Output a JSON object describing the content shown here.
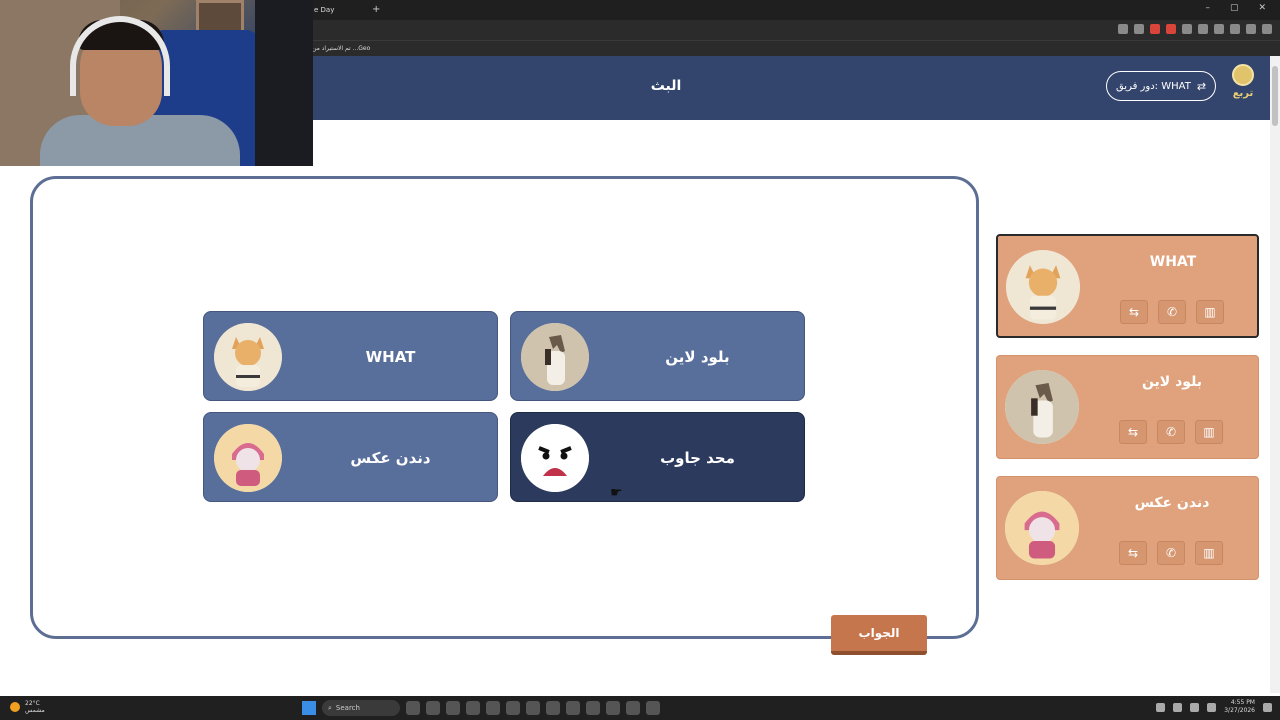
{
  "browser": {
    "tab_label": "e Day",
    "new_tab": "+",
    "bookmark_label": "تم الاستيراد من ...Geo",
    "window_controls": [
      "–",
      "▢",
      "✕"
    ]
  },
  "header": {
    "title": "البث",
    "team_role_button": "دور فريق: WHAT",
    "shuffle_icon": "⇄",
    "logo_text": "تربع"
  },
  "board": {
    "players": [
      {
        "name": "WHAT",
        "avatar": "cat-judo-avatar",
        "active": false
      },
      {
        "name": "بلود لاين",
        "avatar": "horse-avatar",
        "active": false
      },
      {
        "name": "دندن عكس",
        "avatar": "cat-scarf-avatar",
        "active": false
      },
      {
        "name": "محد جاوب",
        "avatar": "angry-face-avatar",
        "active": true
      }
    ],
    "answer_button": "الجواب"
  },
  "teams": [
    {
      "name": "WHAT",
      "avatar": "cat-judo-avatar",
      "selected": true
    },
    {
      "name": "بلود لاين",
      "avatar": "horse-avatar",
      "selected": false
    },
    {
      "name": "دندن عكس",
      "avatar": "cat-scarf-avatar",
      "selected": false
    }
  ],
  "lifeline_icons": [
    "swap-icon",
    "phone-icon",
    "book-icon"
  ],
  "taskbar": {
    "temperature": "22°C",
    "weather_text": "مشمس",
    "search_placeholder": "Search",
    "time": "4:55 PM",
    "date": "3/27/2026"
  },
  "colors": {
    "header_bg": "#33456d",
    "player_card": "#586e9b",
    "player_card_active": "#2c3a5e",
    "team_card": "#e0a27c",
    "answer_button": "#c6764d",
    "stage_border": "#5d6e95"
  }
}
